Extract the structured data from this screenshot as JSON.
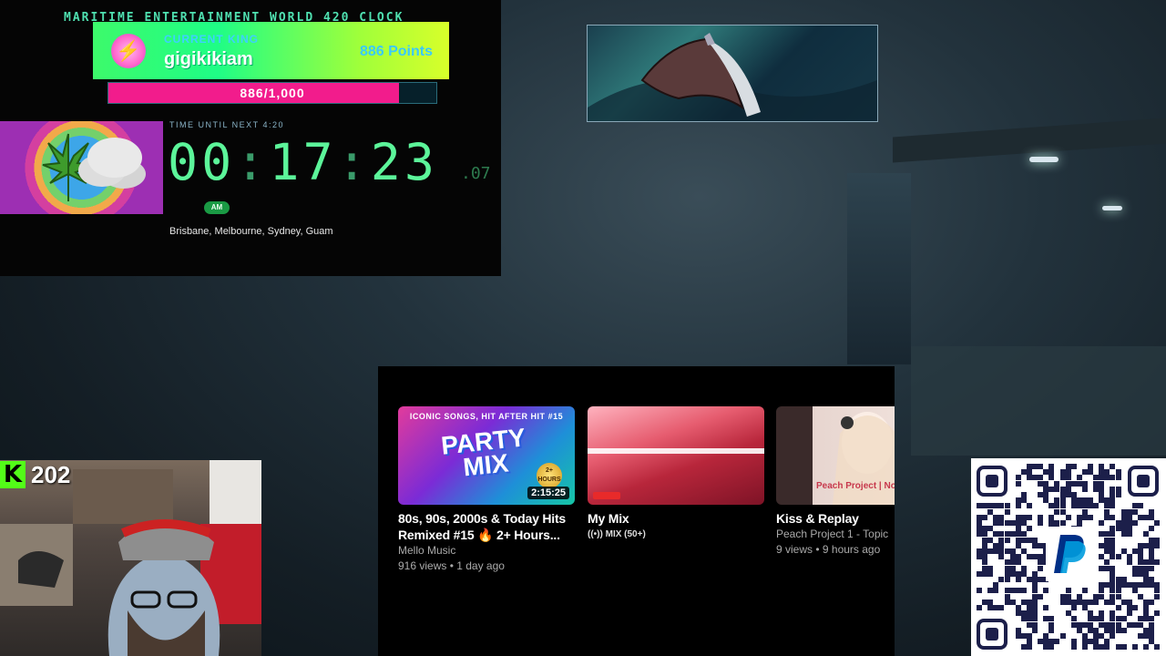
{
  "clock": {
    "title": "MARITIME ENTERTAINMENT WORLD 420 CLOCK",
    "king_label": "CURRENT KING",
    "king_name": "gigikikiam",
    "king_points": "886 Points",
    "progress_text": "886/1,000",
    "progress_fraction": 0.886,
    "next_label": "TIME UNTIL NEXT 4:20",
    "hours": "00",
    "minutes": "17",
    "seconds": "23",
    "fraction": ".07",
    "ampm": "AM",
    "cities": "Brisbane, Melbourne, Sydney, Guam"
  },
  "youtube": {
    "videos": [
      {
        "thumb_top_text": "ICONIC SONGS, HIT AFTER HIT",
        "thumb_episode": "#15",
        "thumb_big_text": "PARTY MIX",
        "thumb_badge": "2+ HOURS",
        "duration": "2:15:25",
        "title_line1": "80s, 90s, 2000s & Today Hits",
        "title_line2": "Remixed #15 🔥 2+ Hours...",
        "channel": "Mello Music",
        "stats": "916 views • 1 day ago"
      },
      {
        "title_line1": "My Mix",
        "sub": "MIX (50+)"
      },
      {
        "thumb_text": "Peach Project | Not In A",
        "title_line1": "Kiss & Replay",
        "channel": "Peach Project 1 - Topic",
        "stats": "9 views • 9 hours ago"
      }
    ]
  },
  "webcam": {
    "kick_logo": "K",
    "follower_count": "202"
  },
  "colors": {
    "clock_green": "#5cf59a",
    "progress_pink": "#f21c8c",
    "kick_green": "#53fc18",
    "qr_navy": "#1c1f4a",
    "paypal_blue": "#0070e0"
  },
  "icons": {
    "king_avatar": "lightning-icon",
    "mix": "radio-waves-icon",
    "qr_center": "paypal-icon"
  }
}
